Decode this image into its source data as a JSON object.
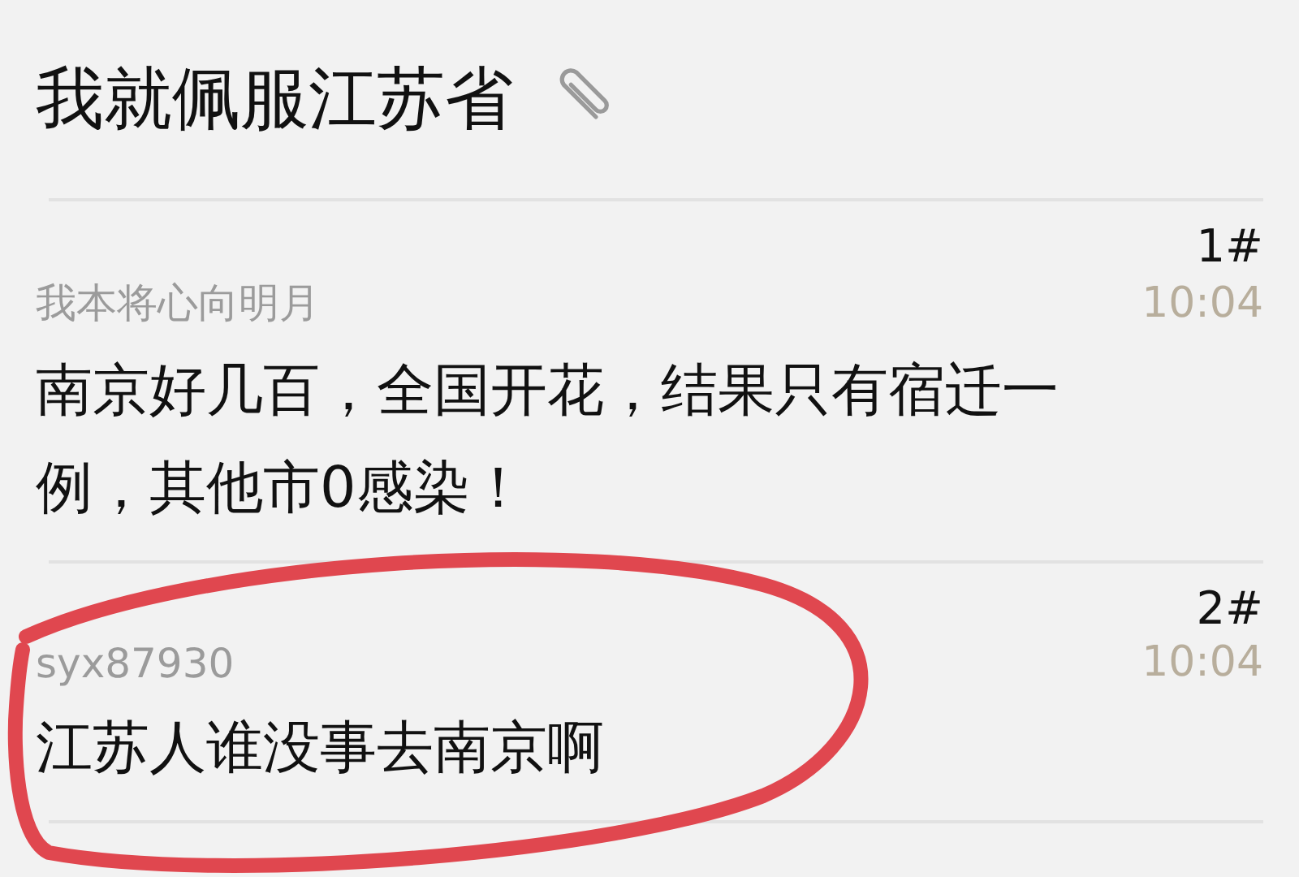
{
  "thread": {
    "title": "我就佩服江苏省",
    "has_attachment": true
  },
  "posts": [
    {
      "floor": "1#",
      "author": "我本将心向明月",
      "time": "10:04",
      "content": "南京好几百，全国开花，结果只有宿迁一例，其他市0感染！"
    },
    {
      "floor": "2#",
      "author": "syx87930",
      "time": "10:04",
      "content": "江苏人谁没事去南京啊"
    }
  ]
}
